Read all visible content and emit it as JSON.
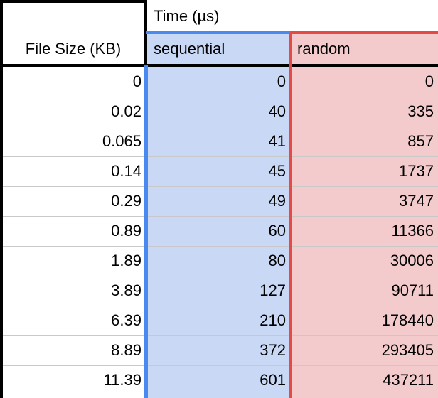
{
  "header": {
    "group_label": "Time (µs)",
    "row_label": "File Size (KB)",
    "col_sequential": "sequential",
    "col_random": "random"
  },
  "colors": {
    "sequential_fill": "#c9d9f5",
    "random_fill": "#f3cbcc",
    "sequential_accent": "#4a8af0",
    "random_accent": "#e64a45",
    "border": "#000000",
    "grid": "#c9c9c9"
  },
  "rows": [
    {
      "size": "0",
      "sequential": "0",
      "random": "0"
    },
    {
      "size": "0.02",
      "sequential": "40",
      "random": "335"
    },
    {
      "size": "0.065",
      "sequential": "41",
      "random": "857"
    },
    {
      "size": "0.14",
      "sequential": "45",
      "random": "1737"
    },
    {
      "size": "0.29",
      "sequential": "49",
      "random": "3747"
    },
    {
      "size": "0.89",
      "sequential": "60",
      "random": "11366"
    },
    {
      "size": "1.89",
      "sequential": "80",
      "random": "30006"
    },
    {
      "size": "3.89",
      "sequential": "127",
      "random": "90711"
    },
    {
      "size": "6.39",
      "sequential": "210",
      "random": "178440"
    },
    {
      "size": "8.89",
      "sequential": "372",
      "random": "293405"
    },
    {
      "size": "11.39",
      "sequential": "601",
      "random": "437211"
    }
  ]
}
